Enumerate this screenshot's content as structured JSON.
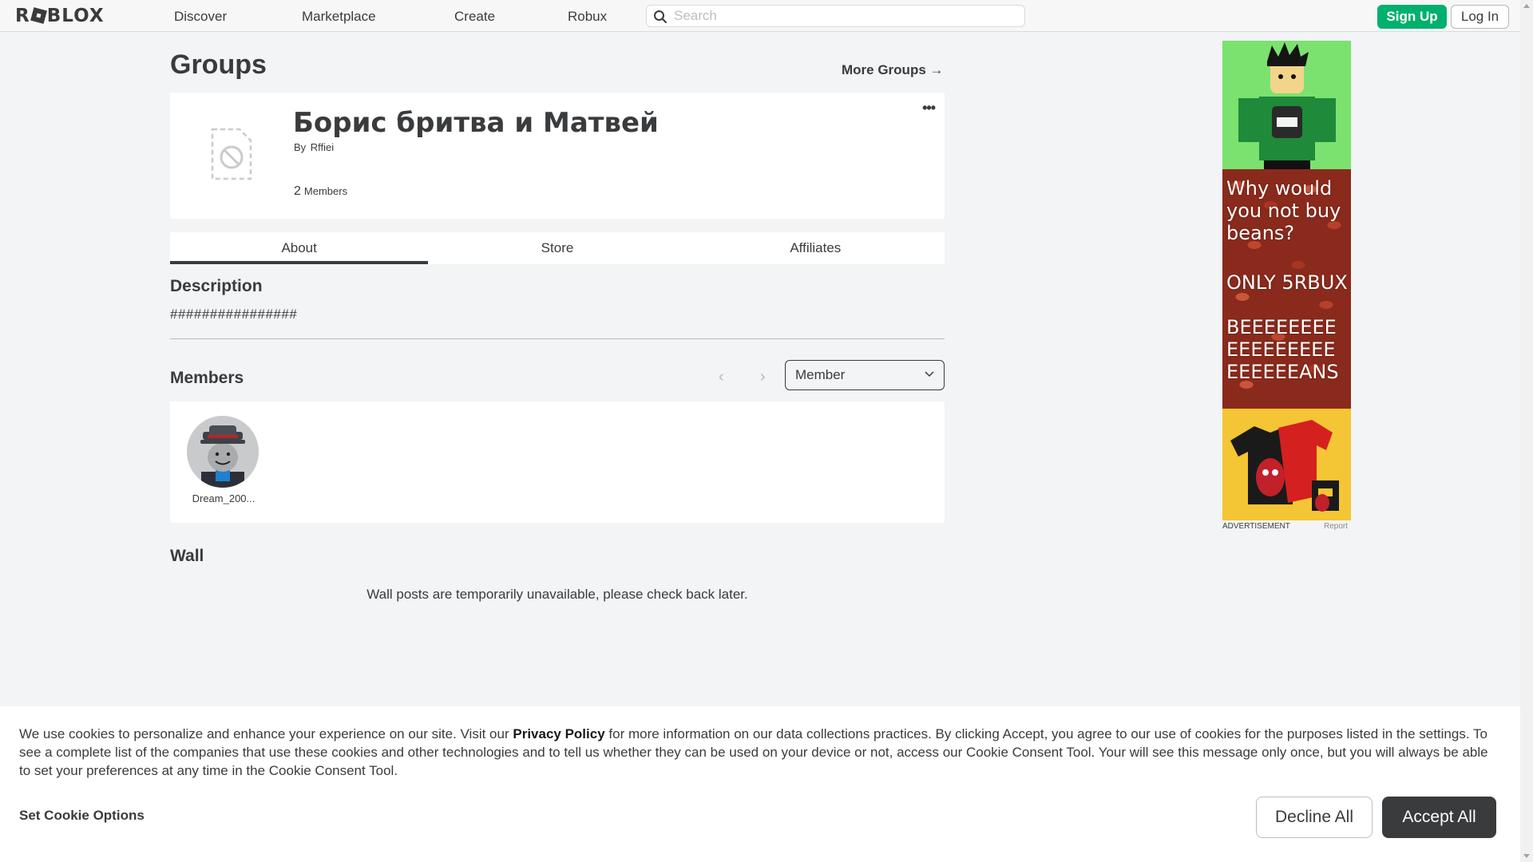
{
  "header": {
    "logo_text": "ROBLOX",
    "nav": [
      {
        "label": "Discover"
      },
      {
        "label": "Marketplace"
      },
      {
        "label": "Create"
      },
      {
        "label": "Robux"
      }
    ],
    "search_placeholder": "Search",
    "signup_label": "Sign Up",
    "login_label": "Log In"
  },
  "page": {
    "title": "Groups",
    "more_groups_label": "More Groups →"
  },
  "group": {
    "name": "Борис бритва и Матвей",
    "by_label": "By",
    "owner": "Rffiei",
    "member_count": "2",
    "members_label": "Members",
    "menu_glyph": "•••"
  },
  "tabs": [
    {
      "label": "About",
      "active": true
    },
    {
      "label": "Store",
      "active": false
    },
    {
      "label": "Affiliates",
      "active": false
    }
  ],
  "description": {
    "heading": "Description",
    "text": "################"
  },
  "members": {
    "heading": "Members",
    "prev_glyph": "‹",
    "next_glyph": "›",
    "role_selected": "Member",
    "list": [
      {
        "name": "Dream_200..."
      }
    ]
  },
  "wall": {
    "heading": "Wall",
    "message": "Wall posts are temporarily unavailable, please check back later."
  },
  "ad": {
    "line1": "Why would\nyou not buy\nbeans?",
    "line2": "ONLY 5RBUX",
    "line3": "BEEEEEEEE\nEEEEEEEEE\nEEEEEEANS",
    "label": "ADVERTISEMENT",
    "report_label": "Report"
  },
  "cookie": {
    "text_before": "We use cookies to personalize and enhance your experience on our site. Visit our ",
    "privacy_label": "Privacy Policy",
    "text_after": " for more information on our data collections practices. By clicking Accept, you agree to our use of cookies for the purposes listed in the settings. To see a complete list of the companies that use these cookies and other technologies and to tell us whether they can be used on your device or not, access our Cookie Consent Tool. Your will see this message only once, but you will always be able to set your preferences at any time in the Cookie Consent Tool.",
    "set_options_label": "Set Cookie Options",
    "decline_label": "Decline All",
    "accept_label": "Accept All"
  },
  "colors": {
    "signup_green": "#00b06f",
    "accept_dark": "#393b3d",
    "page_bg": "#f2f4f5"
  }
}
